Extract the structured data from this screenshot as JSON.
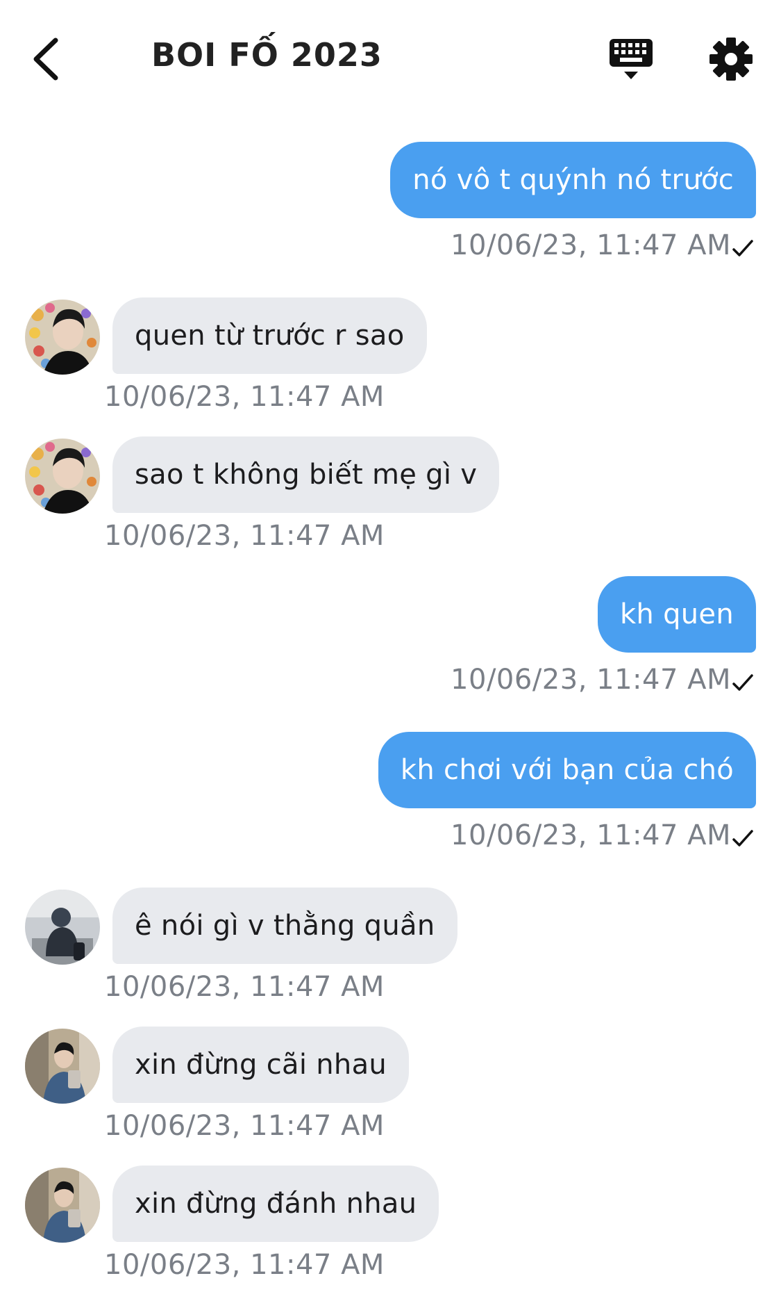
{
  "header": {
    "title": "BOI FỐ 2023",
    "back_icon": "chevron-left-icon",
    "keyboard_icon": "keyboard-icon",
    "settings_icon": "gear-icon"
  },
  "messages": [
    {
      "direction": "out",
      "text": "nó vô t quýnh nó trước",
      "time": "10/06/23, 11:47 AM",
      "read": true
    },
    {
      "direction": "in",
      "text": "quen từ trước r sao",
      "time": "10/06/23, 11:47 AM",
      "sender_avatar": "avatar-1"
    },
    {
      "direction": "in",
      "text": "sao t không biết mẹ gì v",
      "time": "10/06/23, 11:47 AM",
      "sender_avatar": "avatar-1"
    },
    {
      "direction": "out",
      "text": "kh quen",
      "time": "10/06/23, 11:47 AM",
      "read": true
    },
    {
      "direction": "out",
      "text": "kh chơi với bạn của chó",
      "time": "10/06/23, 11:47 AM",
      "read": true
    },
    {
      "direction": "in",
      "text": "ê nói gì v thằng quần",
      "time": "10/06/23, 11:47 AM",
      "sender_avatar": "avatar-2"
    },
    {
      "direction": "in",
      "text": "xin đừng cãi nhau",
      "time": "10/06/23, 11:47 AM",
      "sender_avatar": "avatar-3"
    },
    {
      "direction": "in",
      "text": "xin đừng đánh nhau",
      "time": "10/06/23, 11:47 AM",
      "sender_avatar": "avatar-3"
    }
  ],
  "colors": {
    "outgoing_bubble": "#4a9ff0",
    "incoming_bubble": "#e8eaee",
    "timestamp": "#7a7f87"
  }
}
